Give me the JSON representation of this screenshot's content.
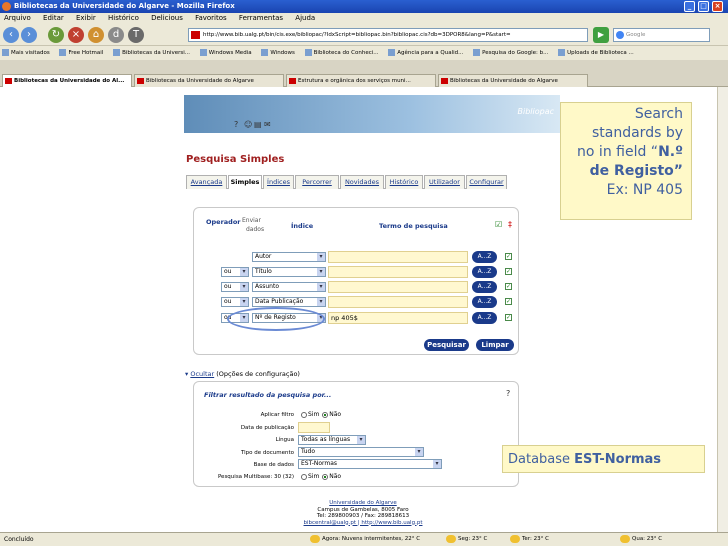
{
  "window": {
    "title": "Bibliotecas da Universidade do Algarve - Mozilla Firefox"
  },
  "menu": [
    "Arquivo",
    "Editar",
    "Exibir",
    "Histórico",
    "Delicious",
    "Favoritos",
    "Ferramentas",
    "Ajuda"
  ],
  "nav": {
    "url": "http://www.bib.ualg.pt/bin/cis.exe/bibliopac/?IdxScript=bibliopac.bin?bibliopac.cis?db=3DPOR8&lang=P&start=",
    "search_placeholder": "Google"
  },
  "bookmarks": [
    "Mais visitados",
    "Free Hotmail",
    "Bibliotecas da Universi...",
    "Windows Media",
    "Windows",
    "Biblioteca do Conheci...",
    "Agência para a Qualid...",
    "Pesquisa do Google: b...",
    "Uploads de Biblioteca ..."
  ],
  "tabs": [
    "Bibliotecas da Universidade do Al...",
    "Bibliotecas da Universidade do Algarve",
    "Estrutura e orgânica dos serviços muni...",
    "Bibliotecas da Universidade do Algarve"
  ],
  "banner": {
    "brand": "Bibliopac"
  },
  "page_title": "Pesquisa Simples",
  "subnav": [
    "Avançada",
    "Simples",
    "Índices",
    "Percorrer",
    "Novidades",
    "Histórico",
    "Utilizador",
    "Configurar"
  ],
  "search": {
    "hdr_operador": "Operador",
    "hdr_enviar": "Enviar",
    "hdr_dados": "dados",
    "hdr_indice": "Índice",
    "hdr_termo": "Termo de pesquisa",
    "rows": [
      {
        "op": "",
        "index": "Autor",
        "term": ""
      },
      {
        "op": "ou",
        "index": "Título",
        "term": ""
      },
      {
        "op": "ou",
        "index": "Assunto",
        "term": ""
      },
      {
        "op": "ou",
        "index": "Data Publicação",
        "term": ""
      },
      {
        "op": "ou",
        "index": "Nº de Registo",
        "term": "np 405$"
      }
    ],
    "az_label": "A...Z",
    "search_button": "Pesquisar",
    "clear_button": "Limpar"
  },
  "config": {
    "hide_link": "Ocultar",
    "text": "(Opções de configuração)"
  },
  "filter": {
    "title": "Filtrar resultado da pesquisa por...",
    "apply_label": "Aplicar filtro",
    "apply_yes": "Sim",
    "apply_no": "Não",
    "date_label": "Data de publicação",
    "lang_label": "Língua",
    "lang_value": "Todas as línguas",
    "doctype_label": "Tipo de documento",
    "doctype_value": "Tudo",
    "db_label": "Base de dados",
    "db_value": "EST-Normas",
    "multi_label": "Pesquisa Multibase: 30 (32)",
    "multi_yes": "Sim",
    "multi_no": "Não"
  },
  "footer": {
    "line1": "Universidade do Algarve",
    "line2": "Campus de Gambelas, 8005 Faro",
    "line3": "Tel: 289800903 / Fax: 289818613",
    "line4": "bibcentral@ualg.pt | http://www.bib.ualg.pt"
  },
  "callout": {
    "lines": [
      "Search",
      "standards by",
      "no in field “"
    ],
    "bold1": "N.º",
    "bold2": "de Registo”",
    "example": "Ex: NP 405"
  },
  "db_callout": {
    "prefix": "Database",
    "name": "EST-Normas"
  },
  "status": {
    "left": "Concluído",
    "weather": "Agora: Nuvens intermitentes, 22° C",
    "days": [
      "Seg: 23° C",
      "Ter: 23° C",
      "Qua: 23° C"
    ]
  },
  "colors": {
    "accent": "#1a3a8a",
    "title_red": "#a02020",
    "callout_bg": "#fff9c8",
    "callout_text": "#4060a0"
  }
}
